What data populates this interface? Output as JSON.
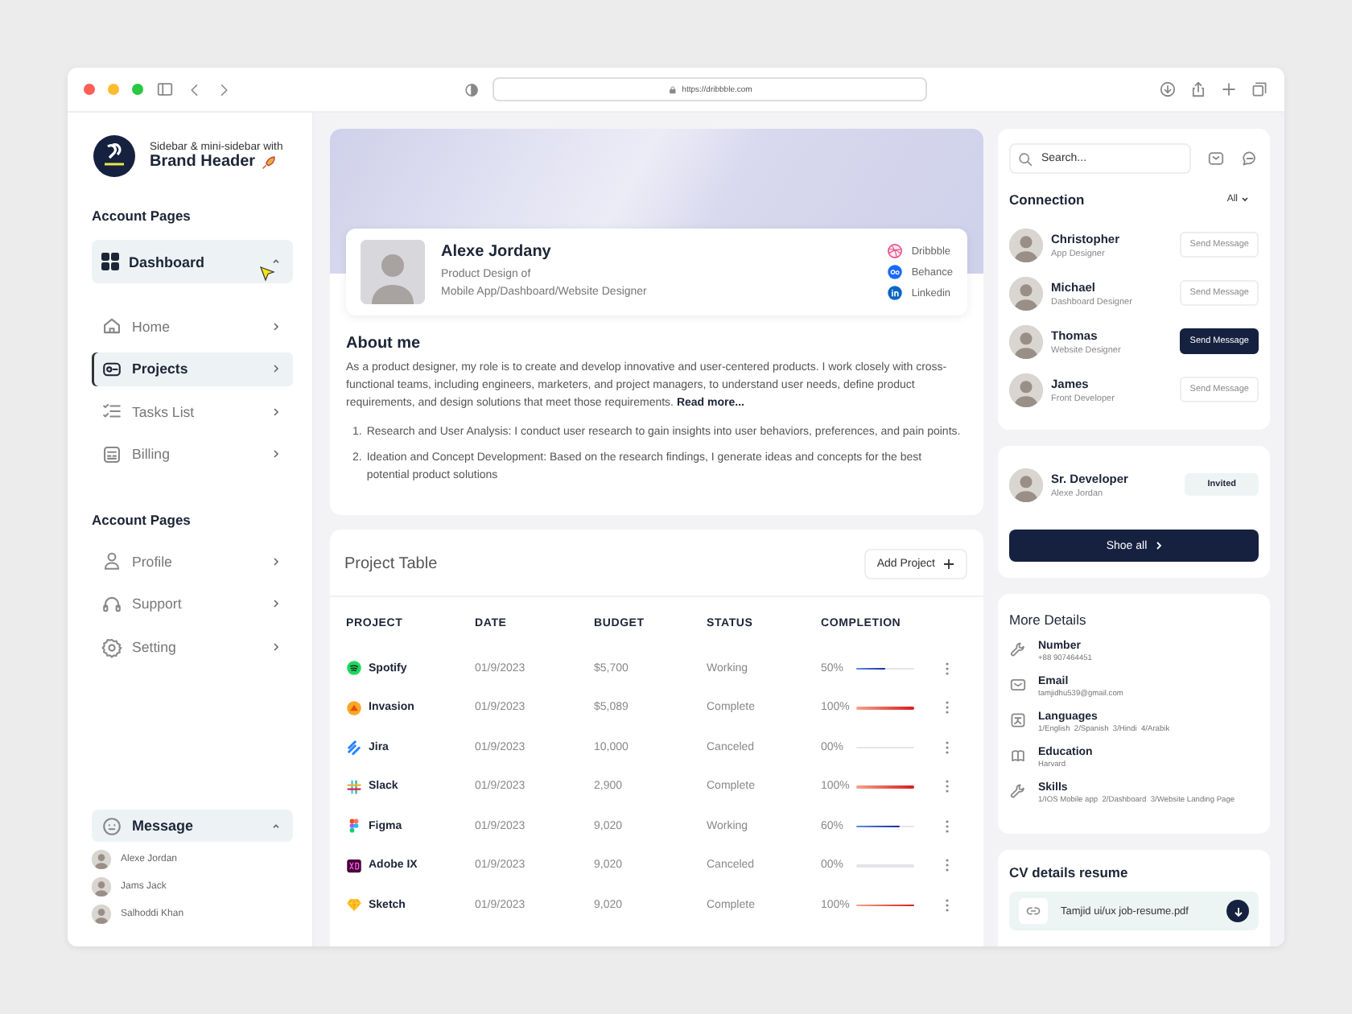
{
  "browser": {
    "url": "https://dribbble.com"
  },
  "brand": {
    "subtitle": "Sidebar & mini-sidebar with",
    "title": "Brand Header"
  },
  "sidebar": {
    "section_title": "Account Pages",
    "dashboard": {
      "label": "Dashboard",
      "expanded": true
    },
    "items": [
      {
        "label": "Home",
        "selected": false
      },
      {
        "label": "Projects",
        "selected": true
      },
      {
        "label": "Tasks List",
        "selected": false
      },
      {
        "label": "Billing",
        "selected": false
      }
    ],
    "section2_title": "Account Pages",
    "items2": [
      {
        "label": "Profile",
        "selected": false
      },
      {
        "label": "Support",
        "selected": false
      },
      {
        "label": "Setting",
        "selected": false
      }
    ],
    "message": {
      "label": "Message",
      "expanded": true,
      "contacts": [
        "Alexe Jordan",
        "Jams Jack",
        "Salhoddi Khan"
      ]
    }
  },
  "profile": {
    "name": "Alexe Jordany",
    "role_lines": [
      "Product Design of",
      "Mobile App/Dashboard/Website Designer"
    ],
    "links": [
      "Dribbble",
      "Behance",
      "Linkedin"
    ],
    "about_title": "About me",
    "about_text": "As a product designer, my role is to create and develop innovative and user-centered products. I work closely with cross-functional teams, including engineers, marketers, and project managers, to understand user needs, define product requirements, and design solutions that meet those requirements.",
    "read_more": "Read more...",
    "points": [
      {
        "marker": "1.",
        "text": "Research and User Analysis: I conduct user research to gain insights into user behaviors, preferences, and pain points."
      },
      {
        "marker": "2.",
        "text": "Ideation and Concept Development: Based on the research findings, I generate ideas and concepts for the best potential product solutions"
      }
    ]
  },
  "table": {
    "title": "Project Table",
    "add_button": "Add Project",
    "columns": [
      "PROJECT",
      "DATE",
      "BUDGET",
      "STATUS",
      "COMPLETION"
    ],
    "rows": [
      {
        "project": "Spotify",
        "date": "01/9/2023",
        "budget": "$5,700",
        "status": "Working",
        "completion": "50%",
        "level": 0.5
      },
      {
        "project": "Invasion",
        "date": "01/9/2023",
        "budget": "$5,089",
        "status": "Complete",
        "completion": "100%",
        "level": 1
      },
      {
        "project": "Jira",
        "date": "01/9/2023",
        "budget": "10,000",
        "status": "Canceled",
        "completion": "00%",
        "level": 0
      },
      {
        "project": "Slack",
        "date": "01/9/2023",
        "budget": "2,900",
        "status": "Complete",
        "completion": "100%",
        "level": 1
      },
      {
        "project": "Figma",
        "date": "01/9/2023",
        "budget": "9,020",
        "status": "Working",
        "completion": "60%",
        "level": 0.75
      },
      {
        "project": "Adobe IX",
        "date": "01/9/2023",
        "budget": "9,020",
        "status": "Canceled",
        "completion": "00%",
        "level": 0
      },
      {
        "project": "Sketch",
        "date": "01/9/2023",
        "budget": "9,020",
        "status": "Complete",
        "completion": "100%",
        "level": 1
      }
    ]
  },
  "search": {
    "placeholder": "Search..."
  },
  "connection": {
    "title": "Connection",
    "filter": "All",
    "people": [
      {
        "name": "Christopher",
        "role": "App Designer",
        "button": "Send Message",
        "selected": false
      },
      {
        "name": "Michael",
        "role": "Dashboard Designer",
        "button": "Send Message",
        "selected": false
      },
      {
        "name": "Thomas",
        "role": "Website Designer",
        "button": "Send Message",
        "selected": true
      },
      {
        "name": "James",
        "role": "Front Developer",
        "button": "Send Message",
        "selected": false
      }
    ]
  },
  "invite": {
    "name": "Sr. Developer",
    "sub": "Alexe Jordan",
    "badge": "Invited",
    "button": "Shoe all"
  },
  "details": {
    "title": "More Details",
    "items": [
      {
        "label": "Number",
        "value": "+88 907464451"
      },
      {
        "label": "Email",
        "value": "tamjidhu539@gmail.com"
      },
      {
        "label": "Languages",
        "value": "1/English  2/Spanish  3/Hindi  4/Arabik"
      },
      {
        "label": "Education",
        "value": "Harvard"
      },
      {
        "label": "Skills",
        "value": "1/IOS Mobile app  2/Dashboard  3/Website Landing Page"
      }
    ]
  },
  "cv": {
    "title": "CV details resume",
    "file": "Tamjid ui/ux job-resume.pdf"
  }
}
